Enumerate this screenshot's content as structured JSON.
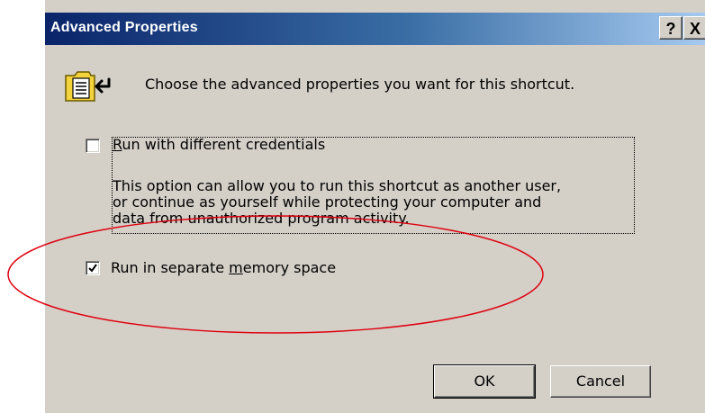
{
  "window": {
    "title": "Advanced Properties",
    "help_button": "?",
    "close_button": "X"
  },
  "heading": "Choose the advanced properties you want for this shortcut.",
  "options": [
    {
      "label_prefix": "",
      "label_mnemonic": "R",
      "label_suffix": "un with different credentials",
      "checked": false
    },
    {
      "label_prefix": "Run in separate ",
      "label_mnemonic": "m",
      "label_suffix": "emory space",
      "checked": true
    }
  ],
  "description_lines": [
    "This option can allow you to run this shortcut as another user,",
    "or continue as yourself while protecting your computer and",
    "data from unauthorized program activity."
  ],
  "buttons": {
    "ok": "OK",
    "cancel": "Cancel"
  },
  "colors": {
    "dialog_bg": "#d4d0c8",
    "titlebar_start": "#0a246a",
    "titlebar_end": "#a6caf0",
    "annotation": "#e0000f"
  },
  "icons": {
    "shortcut": "folder-shortcut-icon",
    "checkmark": "checkmark-icon"
  }
}
